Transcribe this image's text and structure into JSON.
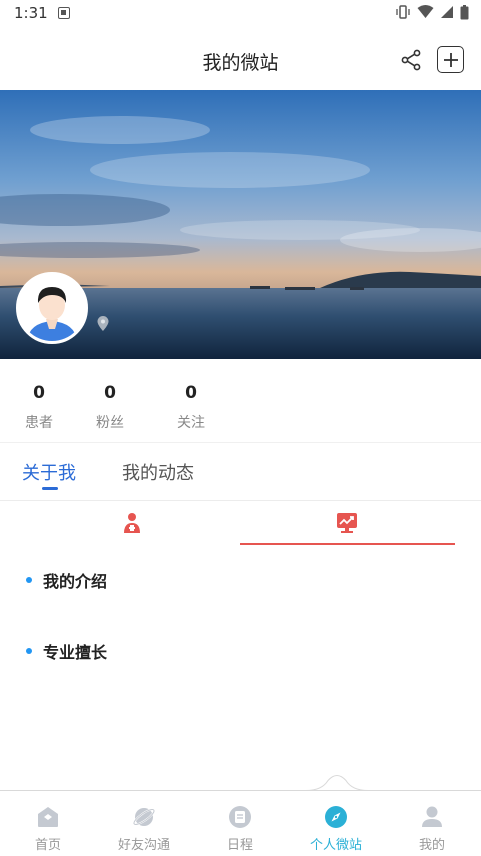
{
  "status_bar": {
    "time": "1:31",
    "icons": [
      "notification-icon",
      "vibrate-icon",
      "wifi-icon",
      "signal-icon",
      "battery-icon"
    ]
  },
  "header": {
    "title": "我的微站",
    "share_icon": "share-icon",
    "add_icon": "add-icon"
  },
  "banner": {
    "scene": "sea-sunset-photo",
    "avatar_icon": "avatar-icon",
    "location_icon": "location-pin-icon"
  },
  "stats": [
    {
      "value": "0",
      "label": "患者"
    },
    {
      "value": "0",
      "label": "粉丝"
    },
    {
      "value": "0",
      "label": "关注"
    }
  ],
  "tabs": {
    "items": [
      {
        "label": "关于我",
        "active": true
      },
      {
        "label": "我的动态",
        "active": false
      }
    ]
  },
  "sub_tabs": {
    "items": [
      {
        "icon": "doctor-icon",
        "active": false
      },
      {
        "icon": "trend-screen-icon",
        "active": true
      }
    ],
    "active_color": "#e65550"
  },
  "sections": [
    {
      "title": "我的介绍"
    },
    {
      "title": "专业擅长"
    }
  ],
  "bottom_nav": {
    "items": [
      {
        "label": "首页",
        "icon": "home-icon",
        "active": false
      },
      {
        "label": "好友沟通",
        "icon": "planet-icon",
        "active": false
      },
      {
        "label": "日程",
        "icon": "schedule-icon",
        "active": false
      },
      {
        "label": "个人微站",
        "icon": "compass-icon",
        "active": true
      },
      {
        "label": "我的",
        "icon": "person-icon",
        "active": false
      }
    ],
    "active_color": "#2bb0d6",
    "inactive_color": "#999999"
  },
  "colors": {
    "accent_blue": "#2b6bd6",
    "dot_blue": "#2196f3",
    "sub_tab_red": "#e65550"
  }
}
